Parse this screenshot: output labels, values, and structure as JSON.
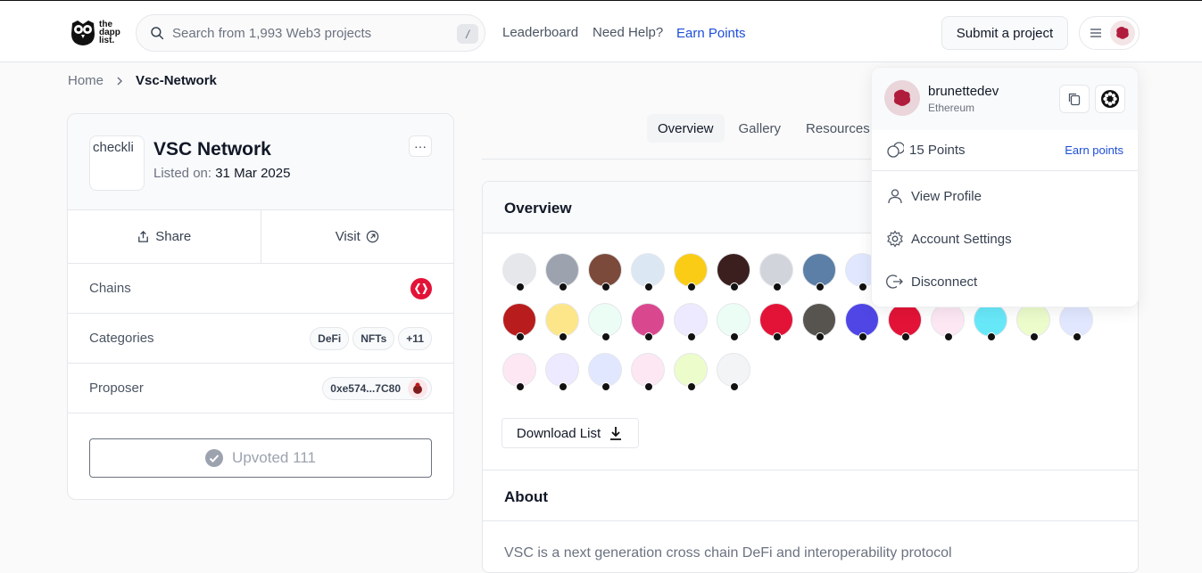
{
  "header": {
    "logo_text": [
      "the",
      "dapp",
      "list."
    ],
    "search_placeholder": "Search from 1,993 Web3 projects",
    "search_shortcut": "/",
    "nav": {
      "leaderboard": "Leaderboard",
      "help": "Need Help?",
      "earn": "Earn Points"
    },
    "submit_label": "Submit a project",
    "accent_color": "#1d4ed8"
  },
  "breadcrumb": {
    "home": "Home",
    "current": "Vsc-Network"
  },
  "project": {
    "logo_alt": "checkli",
    "name": "VSC Network",
    "listed_label": "Listed on:",
    "listed_date": "31 Mar 2025",
    "more_label": "···",
    "share_label": "Share",
    "visit_label": "Visit",
    "chains_label": "Chains",
    "chain_color": "#e31337",
    "categories_label": "Categories",
    "categories": [
      "DeFi",
      "NFTs",
      "+11"
    ],
    "proposer_label": "Proposer",
    "proposer_address": "0xe574...7C80",
    "upvote_label": "Upvoted 111"
  },
  "tabs": [
    "Overview",
    "Gallery",
    "Resources"
  ],
  "overview": {
    "title": "Overview",
    "upvoter_avatars": [
      "#e5e7eb",
      "#9ca3af",
      "#7c4a3a",
      "#dbe8f4",
      "#facc15",
      "#3b1f1f",
      "#d1d5db",
      "#5b7fa6",
      "#e0e7ff",
      "#b91c1c",
      "#fde68a",
      "#ecfdf5",
      "#d9488f",
      "#ede9fe",
      "#ecfdf5",
      "#e31337",
      "#57534e",
      "#4f46e5",
      "#e31337",
      "#fce7f3",
      "#67e8f9",
      "#ecfccb",
      "#e0e7ff",
      "#fce7f3",
      "#ede9fe",
      "#e0e7ff",
      "#fce7f3",
      "#ecfccb",
      "#f3f4f6"
    ],
    "download_label": "Download List"
  },
  "about": {
    "title": "About",
    "text": "VSC is a next generation cross chain DeFi and interoperability protocol"
  },
  "account_menu": {
    "username": "brunettedev",
    "chain": "Ethereum",
    "points": "15 Points",
    "earn_points": "Earn points",
    "items": [
      "View Profile",
      "Account Settings",
      "Disconnect"
    ]
  }
}
